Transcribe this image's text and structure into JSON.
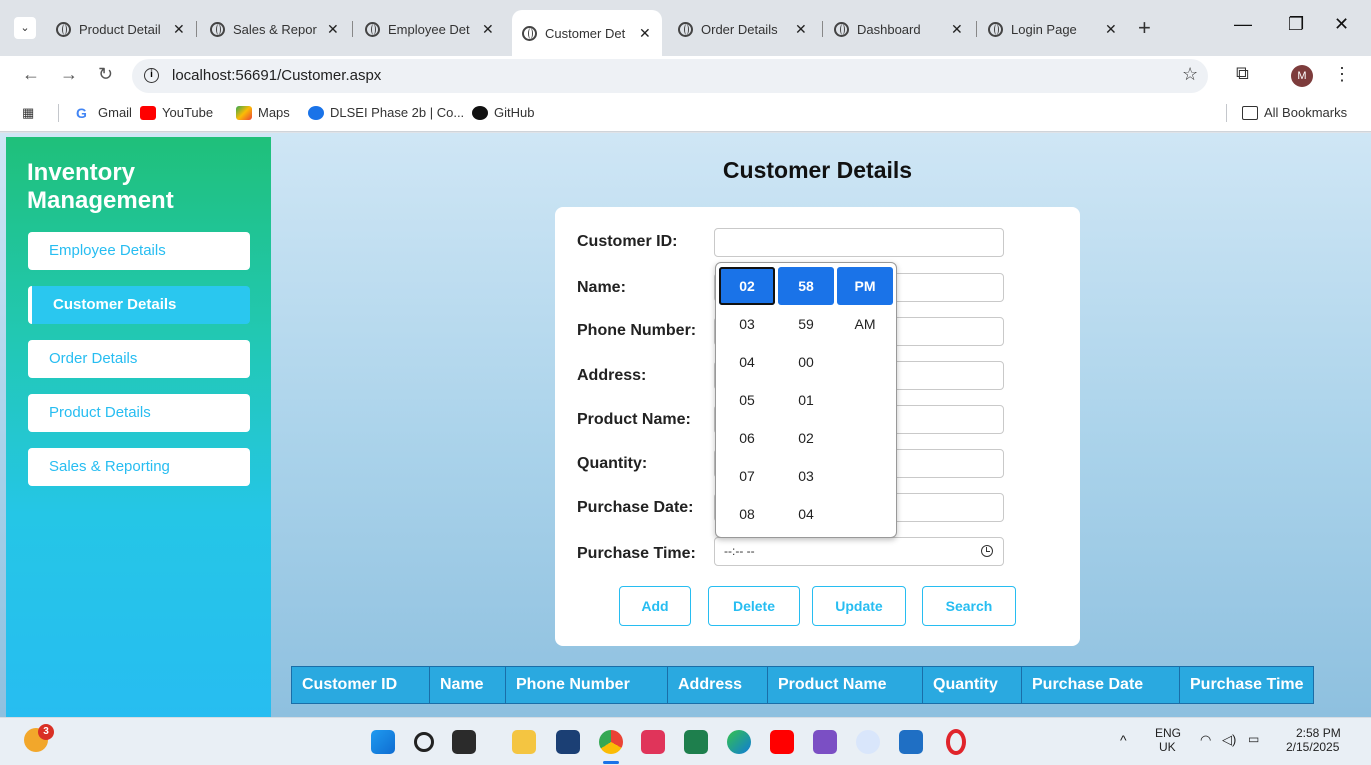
{
  "browser": {
    "tabs": [
      {
        "title": "Product Detail",
        "active": false
      },
      {
        "title": "Sales & Repor",
        "active": false
      },
      {
        "title": "Employee Det",
        "active": false
      },
      {
        "title": "Customer Det",
        "active": true
      },
      {
        "title": "Order Details",
        "active": false
      },
      {
        "title": "Dashboard",
        "active": false
      },
      {
        "title": "Login Page",
        "active": false
      }
    ],
    "url": "localhost:56691/Customer.aspx",
    "profile_initial": "M",
    "bookmarks": [
      "Gmail",
      "YouTube",
      "Maps",
      "DLSEI Phase 2b | Co...",
      "GitHub"
    ],
    "all_bookmarks": "All Bookmarks"
  },
  "sidebar": {
    "brand": "Inventory Management",
    "items": [
      {
        "label": "Employee Details",
        "active": false
      },
      {
        "label": "Customer Details",
        "active": true
      },
      {
        "label": "Order Details",
        "active": false
      },
      {
        "label": "Product Details",
        "active": false
      },
      {
        "label": "Sales & Reporting",
        "active": false
      }
    ]
  },
  "form": {
    "title": "Customer Details",
    "fields": [
      {
        "label": "Customer ID:",
        "value": ""
      },
      {
        "label": "Name:",
        "value": ""
      },
      {
        "label": "Phone Number:",
        "value": ""
      },
      {
        "label": "Address:",
        "value": ""
      },
      {
        "label": "Product Name:",
        "value": ""
      },
      {
        "label": "Quantity:",
        "value": ""
      },
      {
        "label": "Purchase Date:",
        "value": ""
      },
      {
        "label": "Purchase Time:",
        "value": "--:-- --"
      }
    ],
    "buttons": [
      "Add",
      "Delete",
      "Update",
      "Search"
    ]
  },
  "time_picker": {
    "hours": [
      "02",
      "03",
      "04",
      "05",
      "06",
      "07",
      "08"
    ],
    "minutes": [
      "58",
      "59",
      "00",
      "01",
      "02",
      "03",
      "04"
    ],
    "periods": [
      "PM",
      "AM"
    ],
    "selected": {
      "hour": "02",
      "minute": "58",
      "period": "PM"
    }
  },
  "table": {
    "columns": [
      "Customer ID",
      "Name",
      "Phone Number",
      "Address",
      "Product Name",
      "Quantity",
      "Purchase Date",
      "Purchase Time"
    ]
  },
  "taskbar": {
    "notification_badge": "3",
    "lang": "ENG",
    "region": "UK",
    "time": "2:58 PM",
    "date": "2/15/2025"
  },
  "colors": {
    "accent": "#27bdf1",
    "sidebar_top": "#1fc07a",
    "table_header": "#2aa9e0",
    "picker_selected": "#1a73e8"
  }
}
